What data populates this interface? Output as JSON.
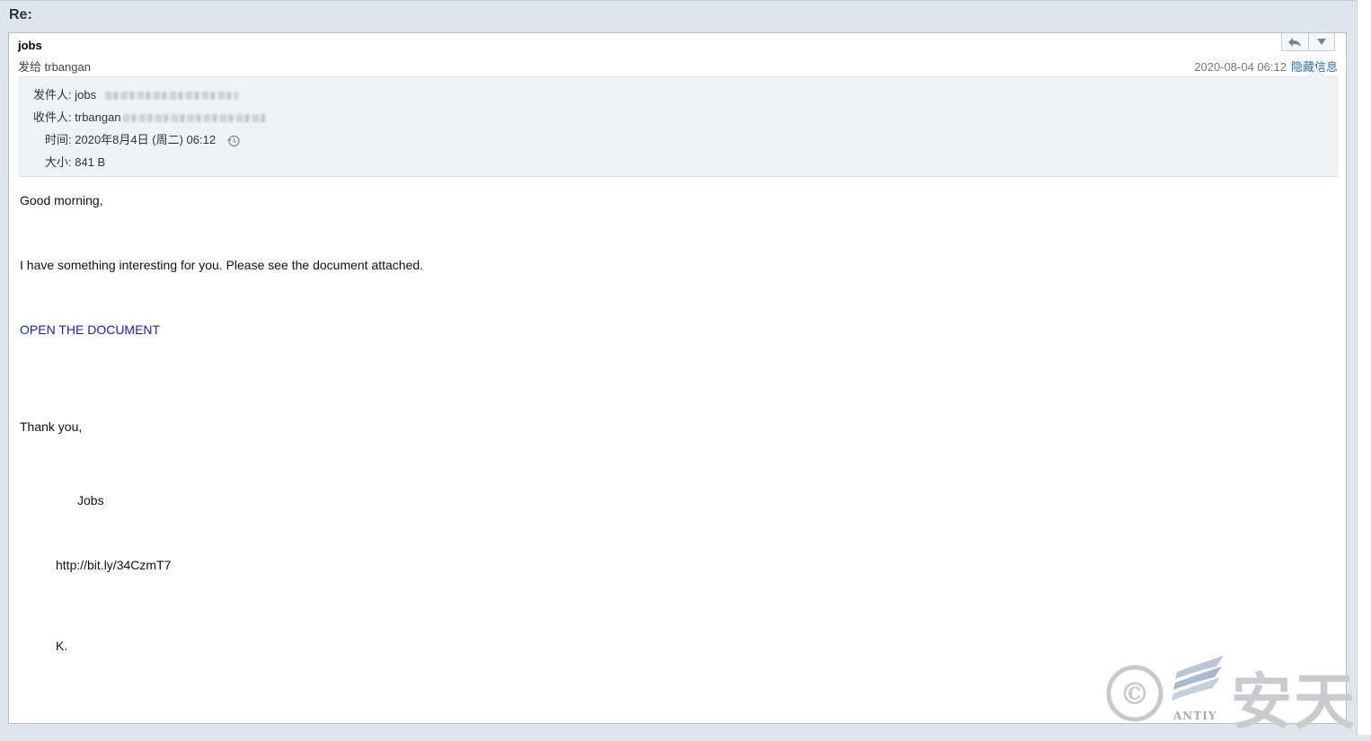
{
  "subject": "Re:",
  "message": {
    "sender_name": "jobs",
    "to_prefix": "发给",
    "to_name": "trbangan",
    "date": "2020-08-04 06:12",
    "hide_details_label": "隐藏信息",
    "actions": {
      "reply_icon": "reply-icon",
      "more_icon": "chevron-down-icon"
    }
  },
  "details": {
    "from_label": "发件人:",
    "from_value": "jobs",
    "to_label": "收件人:",
    "to_value": "trbangan",
    "time_label": "时间:",
    "time_value": "2020年8月4日 (周二) 06:12",
    "size_label": "大小:",
    "size_value": "841 B"
  },
  "body": {
    "greeting": "Good morning,",
    "line1": "I have something interesting for you. Please see the document attached.",
    "link": "OPEN THE DOCUMENT",
    "thanks": "Thank you,",
    "signature_name": "Jobs",
    "url": "http://bit.ly/34CzmT7",
    "initial": "K."
  },
  "watermark": {
    "text": "安天",
    "small": "ANTIY",
    "symbol": "©"
  },
  "colors": {
    "link": "#1a21c8",
    "accent": "#2a6fc0",
    "background": "#dfe5ec"
  }
}
